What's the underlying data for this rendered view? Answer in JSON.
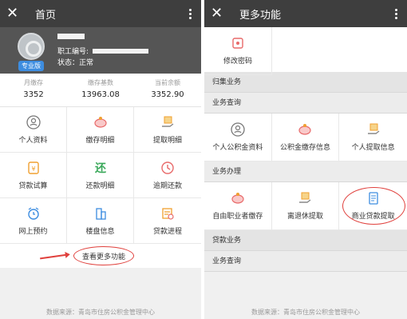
{
  "left": {
    "title": "首页",
    "badge": "专业版",
    "id_label": "职工编号:",
    "status": "状态：正常",
    "stats": [
      {
        "label": "月缴存",
        "value": "3352"
      },
      {
        "label": "缴存基数",
        "value": "13963.08"
      },
      {
        "label": "当前余额",
        "value": "3352.90"
      }
    ],
    "grid": [
      {
        "label": "个人资料",
        "icon": "person-icon"
      },
      {
        "label": "缴存明细",
        "icon": "piggy-bank-icon"
      },
      {
        "label": "提取明细",
        "icon": "hand-coin-icon"
      },
      {
        "label": "贷款试算",
        "icon": "calculator-icon"
      },
      {
        "label": "还款明细",
        "icon": "repay-icon"
      },
      {
        "label": "逾期还款",
        "icon": "clock-icon"
      },
      {
        "label": "网上预约",
        "icon": "alarm-icon"
      },
      {
        "label": "楼盘信息",
        "icon": "building-icon"
      },
      {
        "label": "贷款进程",
        "icon": "progress-icon"
      }
    ],
    "more_label": "查看更多功能",
    "footer": "数据来源：青岛市住房公积金管理中心"
  },
  "right": {
    "title": "更多功能",
    "top_item": {
      "label": "修改密码",
      "icon": "password-icon"
    },
    "section1": "归集业务",
    "sub1": "业务查询",
    "row1": [
      {
        "label": "个人公积金资料",
        "icon": "person-icon"
      },
      {
        "label": "公积金缴存信息",
        "icon": "piggy-bank-icon"
      },
      {
        "label": "个人提取信息",
        "icon": "hand-coin-icon"
      }
    ],
    "sub2": "业务办理",
    "row2": [
      {
        "label": "自由职业者缴存",
        "icon": "piggy-bank-icon"
      },
      {
        "label": "离退休提取",
        "icon": "hand-coin-icon"
      },
      {
        "label": "商业贷款提取",
        "icon": "document-icon"
      }
    ],
    "section2": "贷款业务",
    "sub3": "业务查询",
    "footer": "数据来源：青岛市住房公积金管理中心"
  },
  "colors": {
    "topbar": "#3e3e3e",
    "accent_red": "#e0413d",
    "badge_blue": "#3d8de0",
    "icon_orange": "#f0a030"
  }
}
